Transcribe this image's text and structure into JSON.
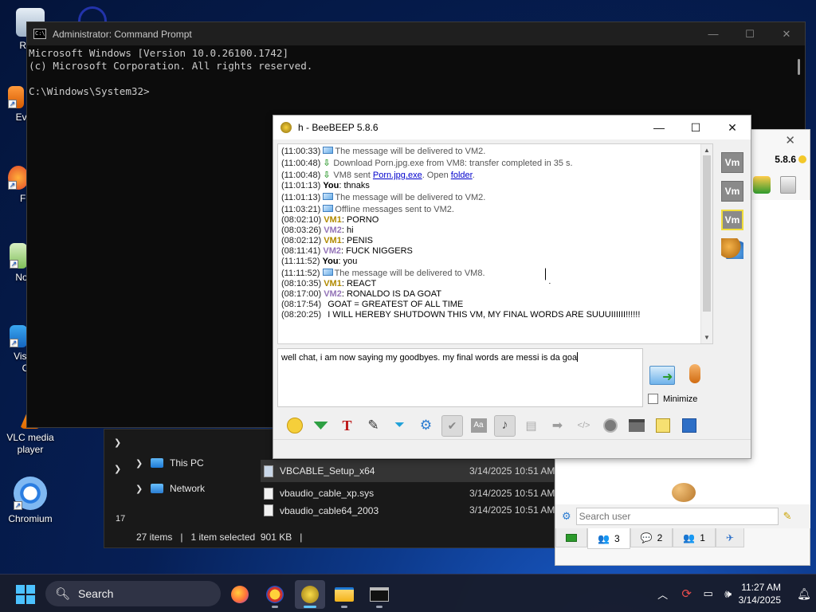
{
  "desktop": {
    "icons": [
      {
        "label": "Recy"
      },
      {
        "label": "Ever"
      },
      {
        "label": "Fir"
      },
      {
        "label": "Note"
      },
      {
        "label": "Visua\nC"
      },
      {
        "label": "VLC media player"
      },
      {
        "label": "Chromium"
      }
    ]
  },
  "cmd": {
    "title": "Administrator: Command Prompt",
    "lines": [
      "Microsoft Windows [Version 10.0.26100.1742]",
      "(c) Microsoft Corporation. All rights reserved.",
      "",
      "C:\\Windows\\System32>"
    ]
  },
  "explorer": {
    "nav": [
      {
        "label": "This PC"
      },
      {
        "label": "Network"
      }
    ],
    "nav_partial_count": "17",
    "files": [
      {
        "name": "VBCABLE_Setup_x64",
        "date": "3/14/2025 10:51 AM",
        "selected": true
      },
      {
        "name": "vbaudio_cable_xp.sys",
        "date": "3/14/2025 10:51 AM",
        "selected": false
      },
      {
        "name": "vbaudio_cable64_2003",
        "date": "3/14/2025 10:51 AM",
        "selected": false
      }
    ],
    "status": {
      "items": "27 items",
      "selection": "1 item selected  901 KB"
    }
  },
  "beebeep_main": {
    "title": "h - BeeBEEP 5.8.6",
    "messages": [
      {
        "ts": "(11:00:33)",
        "kind": "sys",
        "icon": "envelope-icon",
        "text": "The message will be delivered to VM2."
      },
      {
        "ts": "(11:00:48)",
        "kind": "sys",
        "icon": "download-icon",
        "text": "Download Porn.jpg.exe from VM8: transfer completed in 35 s."
      },
      {
        "ts": "(11:00:48)",
        "kind": "sysfile",
        "icon": "download-icon",
        "pre": "VM8 sent ",
        "link1": "Porn.jpg.exe",
        "mid": ". Open ",
        "link2": "folder",
        "post": "."
      },
      {
        "ts": "(11:01:13)",
        "kind": "user",
        "user": "You",
        "ucls": "you",
        "text": " thnaks"
      },
      {
        "ts": "(11:01:13)",
        "kind": "sys",
        "icon": "envelope-icon",
        "text": "The message will be delivered to VM2."
      },
      {
        "ts": "(11:03:21)",
        "kind": "sys",
        "icon": "envelope-icon",
        "text": "Offline messages sent to VM2."
      },
      {
        "ts": "(08:02:10)",
        "kind": "user",
        "user": "VM1",
        "ucls": "vm1",
        "text": " PORNO"
      },
      {
        "ts": "(08:03:26)",
        "kind": "user",
        "user": "VM2",
        "ucls": "vm2",
        "text": " hi"
      },
      {
        "ts": "(08:02:12)",
        "kind": "user",
        "user": "VM1",
        "ucls": "vm1",
        "text": " PENIS"
      },
      {
        "ts": "(08:11:41)",
        "kind": "user",
        "user": "VM2",
        "ucls": "vm2",
        "text": " FUCK NIGGERS"
      },
      {
        "ts": "(11:11:52)",
        "kind": "user",
        "user": "You",
        "ucls": "you",
        "text": " you"
      },
      {
        "ts": "(11:11:52)",
        "kind": "sys",
        "icon": "envelope-icon",
        "text": "The message will be delivered to VM8."
      },
      {
        "ts": "(08:10:35)",
        "kind": "user",
        "user": "VM1",
        "ucls": "vm1",
        "text": " REACT"
      },
      {
        "ts": "(08:17:00)",
        "kind": "user",
        "user": "VM2",
        "ucls": "vm2",
        "text": " RONALDO IS DA GOAT"
      },
      {
        "ts": "(08:17:54)",
        "kind": "cont",
        "text": "GOAT = GREATEST OF ALL TIME"
      },
      {
        "ts": "(08:20:25)",
        "kind": "cont",
        "text": "I WILL HEREBY SHUTDOWN THIS VM, MY FINAL WORDS ARE SUUUIIIIII!!!!!!"
      }
    ],
    "user_colon": ":",
    "input_text": "well chat, i am now saying my goodbyes. my final words are messi is da goa",
    "minimize_label": "Minimize",
    "sidebar": [
      "Vm",
      "Vm",
      "Vm"
    ]
  },
  "beebeep_side": {
    "version": "5.8.6",
    "search_placeholder": "Search user",
    "tabs": [
      {
        "count": "3"
      },
      {
        "count": "2"
      },
      {
        "count": "1"
      }
    ]
  },
  "taskbar": {
    "search_label": "Search",
    "time": "11:27 AM",
    "date": "3/14/2025"
  },
  "colors": {
    "vm1": "#b08a00",
    "vm2": "#9474b8",
    "accent": "#4cc2ff"
  }
}
